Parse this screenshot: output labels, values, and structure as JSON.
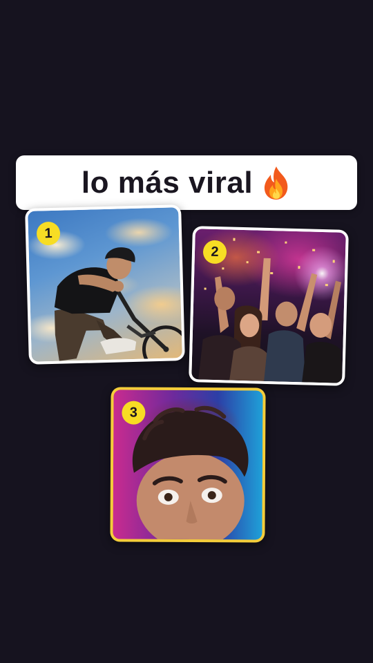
{
  "title": {
    "text": "lo más viral",
    "icon": "fire-icon"
  },
  "cards": [
    {
      "badge": "1",
      "photo": "bmx-rider-photo"
    },
    {
      "badge": "2",
      "photo": "concert-crowd-photo"
    },
    {
      "badge": "3",
      "photo": "surprised-man-photo"
    }
  ],
  "colors": {
    "background": "#16131f",
    "banner": "#ffffff",
    "badge": "#f7dd24",
    "card3_border": "#f4cd3a"
  }
}
